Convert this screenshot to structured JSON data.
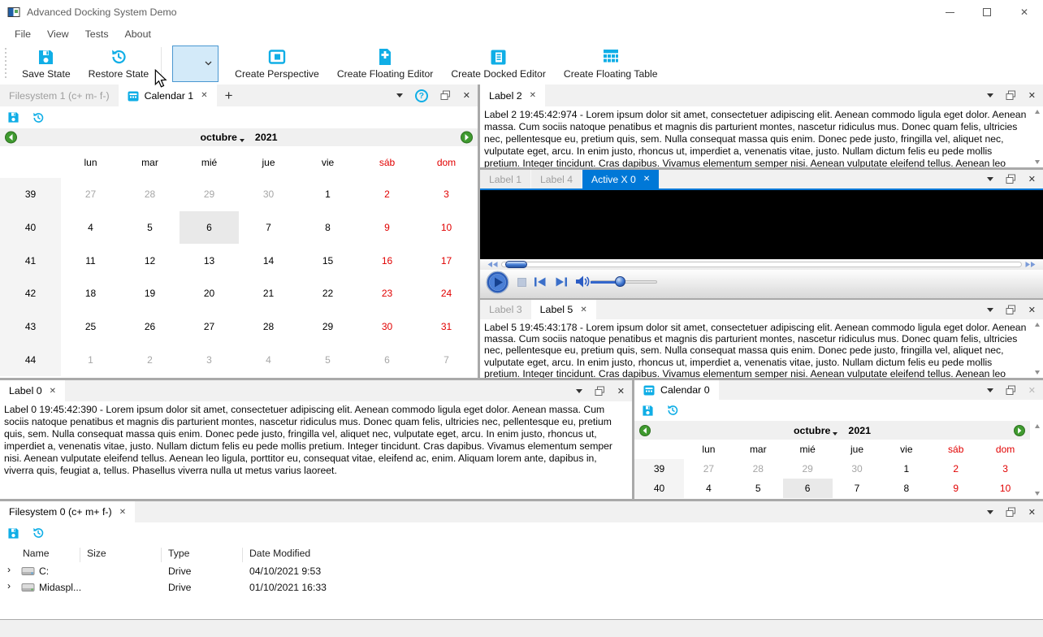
{
  "app": {
    "title": "Advanced Docking System Demo"
  },
  "window_controls": {
    "close": "✕"
  },
  "menu": {
    "items": [
      {
        "label": "File"
      },
      {
        "label": "View"
      },
      {
        "label": "Tests"
      },
      {
        "label": "About"
      }
    ]
  },
  "toolbar": {
    "buttons": [
      {
        "label": "Save State"
      },
      {
        "label": "Restore State"
      },
      {
        "label": "Create Perspective"
      },
      {
        "label": "Create Floating Editor"
      },
      {
        "label": "Create Docked Editor"
      },
      {
        "label": "Create Floating Table"
      }
    ],
    "perspective_combo_value": ""
  },
  "icons": {
    "close": "✕",
    "add_tab": "+",
    "help": "?"
  },
  "dock": {
    "calendar1": {
      "tab_filesystem": "Filesystem 1 (c+ m- f-)",
      "tab_calendar": "Calendar 1"
    },
    "label2": {
      "tab": "Label 2",
      "text": "Label 2 19:45:42:974 - Lorem ipsum dolor sit amet, consectetuer adipiscing elit. Aenean commodo ligula eget dolor. Aenean massa. Cum sociis natoque penatibus et magnis dis parturient montes, nascetur ridiculus mus. Donec quam felis, ultricies nec, pellentesque eu, pretium quis, sem. Nulla consequat massa quis enim. Donec pede justo, fringilla vel, aliquet nec, vulputate eget, arcu. In enim justo, rhoncus ut, imperdiet a, venenatis vitae, justo. Nullam dictum felis eu pede mollis pretium. Integer tincidunt. Cras dapibus. Vivamus elementum semper nisi. Aenean vulputate eleifend tellus. Aenean leo ligula, porttitor eu, consequat vitae, eleifend ac, enim. Aliquam"
    },
    "activex": {
      "tab_label1": "Label 1",
      "tab_label4": "Label 4",
      "tab_active": "Active X 0"
    },
    "label5": {
      "tab_label3": "Label 3",
      "tab": "Label 5",
      "text": "Label 5 19:45:43:178 - Lorem ipsum dolor sit amet, consectetuer adipiscing elit. Aenean commodo ligula eget dolor. Aenean massa. Cum sociis natoque penatibus et magnis dis parturient montes, nascetur ridiculus mus. Donec quam felis, ultricies nec, pellentesque eu, pretium quis, sem. Nulla consequat massa quis enim. Donec pede justo, fringilla vel, aliquet nec, vulputate eget, arcu. In enim justo, rhoncus ut, imperdiet a, venenatis vitae, justo. Nullam dictum felis eu pede mollis pretium. Integer tincidunt. Cras dapibus. Vivamus elementum semper nisi. Aenean vulputate eleifend tellus. Aenean leo ligula, porttitor eu, consequat vitae, eleifend ac, enim. Aliquam"
    },
    "label0": {
      "tab": "Label 0",
      "text": "Label 0 19:45:42:390 - Lorem ipsum dolor sit amet, consectetuer adipiscing elit. Aenean commodo ligula eget dolor. Aenean massa. Cum sociis natoque penatibus et magnis dis parturient montes, nascetur ridiculus mus. Donec quam felis, ultricies nec, pellentesque eu, pretium quis, sem. Nulla consequat massa quis enim. Donec pede justo, fringilla vel, aliquet nec, vulputate eget, arcu. In enim justo, rhoncus ut, imperdiet a, venenatis vitae, justo. Nullam dictum felis eu pede mollis pretium. Integer tincidunt. Cras dapibus. Vivamus elementum semper nisi. Aenean vulputate eleifend tellus. Aenean leo ligula, porttitor eu, consequat vitae, eleifend ac, enim. Aliquam lorem ante, dapibus in, viverra quis, feugiat a, tellus. Phasellus viverra nulla ut metus varius laoreet."
    },
    "calendar0": {
      "tab": "Calendar 0"
    },
    "filesystem0": {
      "tab": "Filesystem 0 (c+ m+ f-)"
    }
  },
  "calendar": {
    "month": "octubre",
    "year": "2021",
    "day_headers": [
      {
        "label": "lun",
        "weekend": false
      },
      {
        "label": "mar",
        "weekend": false
      },
      {
        "label": "mié",
        "weekend": false
      },
      {
        "label": "jue",
        "weekend": false
      },
      {
        "label": "vie",
        "weekend": false
      },
      {
        "label": "sáb",
        "weekend": true
      },
      {
        "label": "dom",
        "weekend": true
      }
    ],
    "weeks": [
      {
        "num": "39",
        "days": [
          {
            "d": "27",
            "state": "other"
          },
          {
            "d": "28",
            "state": "other"
          },
          {
            "d": "29",
            "state": "other"
          },
          {
            "d": "30",
            "state": "other"
          },
          {
            "d": "1",
            "state": "normal"
          },
          {
            "d": "2",
            "state": "weekend"
          },
          {
            "d": "3",
            "state": "weekend"
          }
        ]
      },
      {
        "num": "40",
        "days": [
          {
            "d": "4",
            "state": "normal"
          },
          {
            "d": "5",
            "state": "normal"
          },
          {
            "d": "6",
            "state": "selected"
          },
          {
            "d": "7",
            "state": "normal"
          },
          {
            "d": "8",
            "state": "normal"
          },
          {
            "d": "9",
            "state": "weekend"
          },
          {
            "d": "10",
            "state": "weekend"
          }
        ]
      },
      {
        "num": "41",
        "days": [
          {
            "d": "11",
            "state": "normal"
          },
          {
            "d": "12",
            "state": "normal"
          },
          {
            "d": "13",
            "state": "normal"
          },
          {
            "d": "14",
            "state": "normal"
          },
          {
            "d": "15",
            "state": "normal"
          },
          {
            "d": "16",
            "state": "weekend"
          },
          {
            "d": "17",
            "state": "weekend"
          }
        ]
      },
      {
        "num": "42",
        "days": [
          {
            "d": "18",
            "state": "normal"
          },
          {
            "d": "19",
            "state": "normal"
          },
          {
            "d": "20",
            "state": "normal"
          },
          {
            "d": "21",
            "state": "normal"
          },
          {
            "d": "22",
            "state": "normal"
          },
          {
            "d": "23",
            "state": "weekend"
          },
          {
            "d": "24",
            "state": "weekend"
          }
        ]
      },
      {
        "num": "43",
        "days": [
          {
            "d": "25",
            "state": "normal"
          },
          {
            "d": "26",
            "state": "normal"
          },
          {
            "d": "27",
            "state": "normal"
          },
          {
            "d": "28",
            "state": "normal"
          },
          {
            "d": "29",
            "state": "normal"
          },
          {
            "d": "30",
            "state": "weekend"
          },
          {
            "d": "31",
            "state": "weekend"
          }
        ]
      },
      {
        "num": "44",
        "days": [
          {
            "d": "1",
            "state": "other"
          },
          {
            "d": "2",
            "state": "other"
          },
          {
            "d": "3",
            "state": "other"
          },
          {
            "d": "4",
            "state": "other"
          },
          {
            "d": "5",
            "state": "other"
          },
          {
            "d": "6",
            "state": "other"
          },
          {
            "d": "7",
            "state": "other"
          }
        ]
      }
    ]
  },
  "filesystem": {
    "headers": [
      "Name",
      "Size",
      "Type",
      "Date Modified"
    ],
    "rows": [
      {
        "name": "C:",
        "size": "",
        "type": "Drive",
        "date_modified": "04/10/2021 9:53",
        "icon": "drive-icon"
      },
      {
        "name": "Midaspl...",
        "size": "",
        "type": "Drive",
        "date_modified": "01/10/2021 16:33",
        "icon": "network-drive-icon"
      }
    ]
  },
  "colors": {
    "accent": "#0078d7",
    "icon_cyan": "#10aee6",
    "weekend_red": "#e10000",
    "selection_bg": "#e9e9e9"
  }
}
